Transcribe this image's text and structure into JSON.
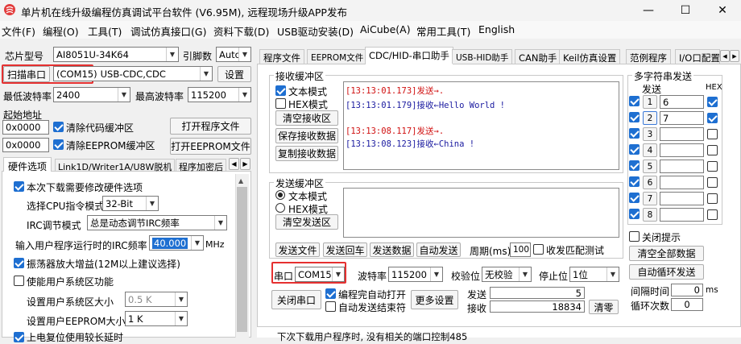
{
  "window": {
    "title": "单片机在线升级编程仿真调试平台软件 (V6.95M), 远程现场升级APP发布",
    "minimize": "—",
    "maximize": "☐",
    "close": "✕"
  },
  "menu": [
    "文件(F)",
    "编程(O)",
    "工具(T)",
    "调试仿真接口(G)",
    "资料下载(D)",
    "USB驱动安装(D)",
    "AiCube(A)",
    "常用工具(T)",
    "English"
  ],
  "left": {
    "chip_label": "芯片型号",
    "chip_value": "AI8051U-34K64",
    "pin_label": "引脚数",
    "pin_value": "Auto",
    "scan_button": "扫描串口",
    "com_value": "(COM15)",
    "com_desc": "USB-CDC,CDC",
    "settings_button": "设置",
    "min_baud_label": "最低波特率",
    "min_baud_value": "2400",
    "max_baud_label": "最高波特率",
    "max_baud_value": "115200",
    "start_addr_label": "起始地址",
    "addr1_value": "0x0000",
    "clear_code_label": "清除代码缓冲区",
    "open_program_button": "打开程序文件",
    "addr2_value": "0x0000",
    "clear_eeprom_label": "清除EEPROM缓冲区",
    "open_eeprom_button": "打开EEPROM文件",
    "tabs": [
      "硬件选项",
      "Link1D/Writer1A/U8W脱机",
      "程序加密后"
    ],
    "hw": {
      "modify_hw_label": "本次下载需要修改硬件选项",
      "cpu_mode_label": "选择CPU指令模式",
      "cpu_mode_value": "32-Bit",
      "irc_mode_label": "IRC调节模式",
      "irc_mode_value": "总是动态调节IRC频率",
      "irc_freq_label": "输入用户程序运行时的IRC频率",
      "irc_freq_value": "40.000",
      "irc_freq_unit": "MHz",
      "osc_gain_label": "振荡器放大增益(12M以上建议选择)",
      "user_sys_label": "使能用户系统区功能",
      "sys_size_label": "设置用户系统区大小",
      "sys_size_value": "0.5 K",
      "eeprom_size_label": "设置用户EEPROM大小",
      "eeprom_size_value": "1   K",
      "reset_label": "上电复位使用较长延时"
    }
  },
  "right": {
    "tabs": [
      "程序文件",
      "EEPROM文件",
      "CDC/HID-串口助手",
      "USB-HID助手",
      "CAN助手",
      "Keil仿真设置",
      "范例程序",
      "I/O口配置"
    ],
    "recv": {
      "group_label": "接收缓冲区",
      "text_mode": "文本模式",
      "hex_mode": "HEX模式",
      "clear_recv": "清空接收区",
      "save_recv": "保存接收数据",
      "copy_recv": "复制接收数据",
      "lines": [
        {
          "text": "[13:13:01.173]发送→.",
          "color": "#d01010"
        },
        {
          "text": "[13:13:01.179]接收←Hello World !",
          "color": "#1a1aa0"
        },
        {
          "text": "",
          "color": "#000"
        },
        {
          "text": "[13:13:08.117]发送→.",
          "color": "#d01010"
        },
        {
          "text": "[13:13:08.123]接收←China !",
          "color": "#1a1aa0"
        }
      ]
    },
    "send": {
      "group_label": "发送缓冲区",
      "text_mode": "文本模式",
      "hex_mode": "HEX模式",
      "clear_send": "清空发送区",
      "send_file": "发送文件",
      "send_cr": "发送回车",
      "send_data": "发送数据",
      "auto_send": "自动发送",
      "period_label": "周期(ms)",
      "period_value": "100",
      "recv_match_label": "收发匹配测试"
    },
    "port": {
      "port_label": "串口",
      "port_value": "COM15",
      "baud_label": "波特率",
      "baud_value": "115200",
      "parity_label": "校验位",
      "parity_value": "无校验",
      "stop_label": "停止位",
      "stop_value": "1位",
      "close_port": "关闭串口",
      "auto_open_label": "编程完自动打开",
      "auto_end_label": "自动发送结束符",
      "more_settings": "更多设置",
      "send_count_label": "发送",
      "send_count_value": "5",
      "recv_count_label": "接收",
      "recv_count_value": "18834",
      "clear_count": "清零"
    },
    "multi": {
      "group_label": "多字符串发送",
      "send_header": "发送",
      "hex_header": "HEX",
      "rows": [
        {
          "n": "1",
          "value": "6"
        },
        {
          "n": "2",
          "value": "7"
        },
        {
          "n": "3",
          "value": ""
        },
        {
          "n": "4",
          "value": ""
        },
        {
          "n": "5",
          "value": ""
        },
        {
          "n": "6",
          "value": ""
        },
        {
          "n": "7",
          "value": ""
        },
        {
          "n": "8",
          "value": ""
        }
      ],
      "close_tip": "关闭提示",
      "clear_all": "清空全部数据",
      "auto_loop": "自动循环发送",
      "interval_label": "间隔时间",
      "interval_value": "0",
      "interval_unit": "ms",
      "loop_label": "循环次数",
      "loop_value": "0"
    },
    "status_text": "下次下载用户程序时, 没有相关的端口控制485"
  }
}
